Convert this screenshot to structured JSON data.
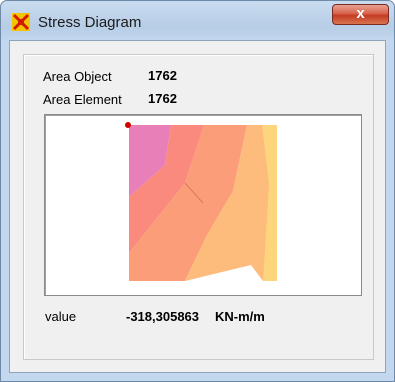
{
  "window": {
    "title": "Stress Diagram",
    "close_label": "x"
  },
  "info": {
    "area_object_label": "Area Object",
    "area_object_value": "1762",
    "area_element_label": "Area Element",
    "area_element_value": "1762"
  },
  "readout": {
    "label": "value",
    "value": "-318,305863",
    "unit": "KN-m/m"
  },
  "colors": {
    "band_pink": "#e97fb8",
    "band_red": "#f98a7d",
    "band_salmon": "#fb9d79",
    "band_orange": "#fdbb7c",
    "band_yellow": "#fcd57d",
    "marker": "#d40000"
  }
}
